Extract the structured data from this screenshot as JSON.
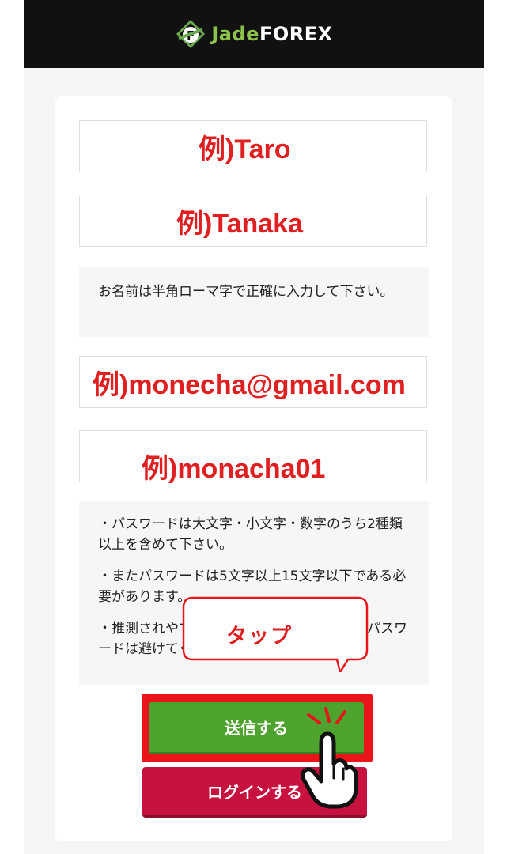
{
  "header": {
    "logo_jade": "Jade",
    "logo_forex": "FOREX"
  },
  "form": {
    "first_name_example": "例)Taro",
    "last_name_example": "例)Tanaka",
    "name_note": "お名前は半角ローマ字で正確に入力して下さい。",
    "email_example": "例)monecha@gmail.com",
    "password_example": "例)monacha01",
    "password_notes": [
      "・パスワードは大文字・小文字・数字のうち2種類以上を含めて下さい。",
      "・またパスワードは5文字以上15文字以下である必要があります。",
      "・推測されやすい文字列、または繰り返しのパスワードは避けてください。"
    ]
  },
  "buttons": {
    "submit_label": "送信する",
    "login_label": "ログインする"
  },
  "annotation": {
    "tap_label": "タップ"
  },
  "colors": {
    "header_bg": "#111111",
    "accent_green": "#4ea22e",
    "accent_red": "#c7123f",
    "highlight_red": "#e8161a",
    "example_text_red": "#e02020"
  }
}
